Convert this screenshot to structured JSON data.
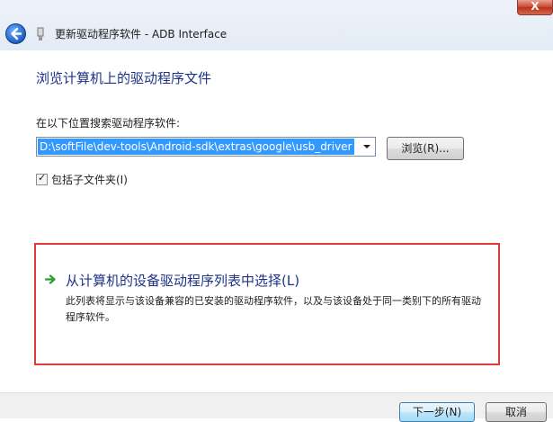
{
  "window": {
    "close_glyph": "X",
    "title": "更新驱动程序软件 - ADB Interface"
  },
  "page": {
    "heading": "浏览计算机上的驱动程序文件",
    "search_label": "在以下位置搜索驱动程序软件:",
    "path_value": "D:\\softFile\\dev-tools\\Android-sdk\\extras\\google\\usb_driver",
    "browse_label": "浏览(R)...",
    "include_subfolders_label": "包括子文件夹(I)",
    "include_subfolders_checked": true
  },
  "option": {
    "title": "从计算机的设备驱动程序列表中选择(L)",
    "description": "此列表将显示与该设备兼容的已安装的驱动程序软件，以及与该设备处于同一类别下的所有驱动程序软件。",
    "highlight_color": "#e03a3a",
    "arrow_color": "#2e9e2e"
  },
  "footer": {
    "next_label": "下一步(N)",
    "cancel_label": "取消"
  },
  "colors": {
    "heading": "#1e3287",
    "selection": "#3399ff"
  }
}
